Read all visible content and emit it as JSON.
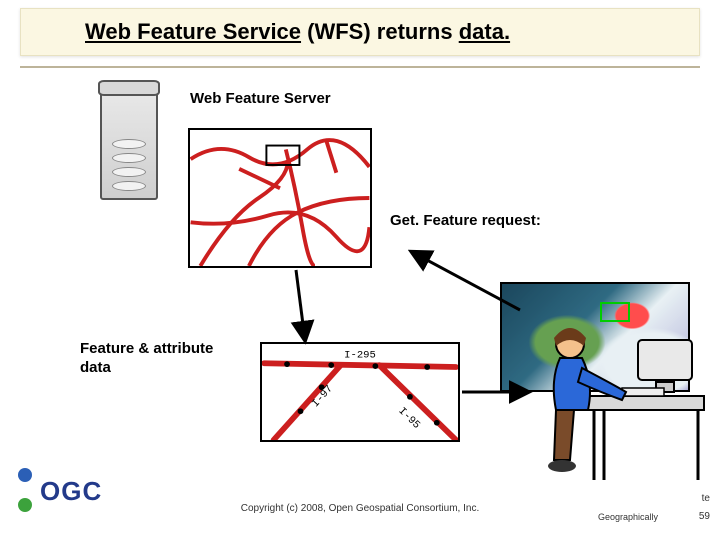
{
  "title": {
    "t1": "Web Feature Service",
    "t2": " (WFS) ",
    "t3": "returns ",
    "t4": "data."
  },
  "labels": {
    "wfs_server": "Web Feature Server",
    "get_feature": "Get. Feature request:",
    "feature_attr": "Feature & attribute data"
  },
  "roads_detail": {
    "i295": "I-295",
    "i97": "I-97",
    "i95": "I-95"
  },
  "logo_text": "OGC",
  "footer": {
    "copyright": "Copyright (c) 2008, Open Geospatial Consortium, Inc.",
    "corner_left": "Geographically",
    "corner_te": "te",
    "corner_num": "59"
  },
  "colors": {
    "road": "#cc1f1f",
    "accent_green": "#34a853",
    "panel_border": "#000000"
  }
}
